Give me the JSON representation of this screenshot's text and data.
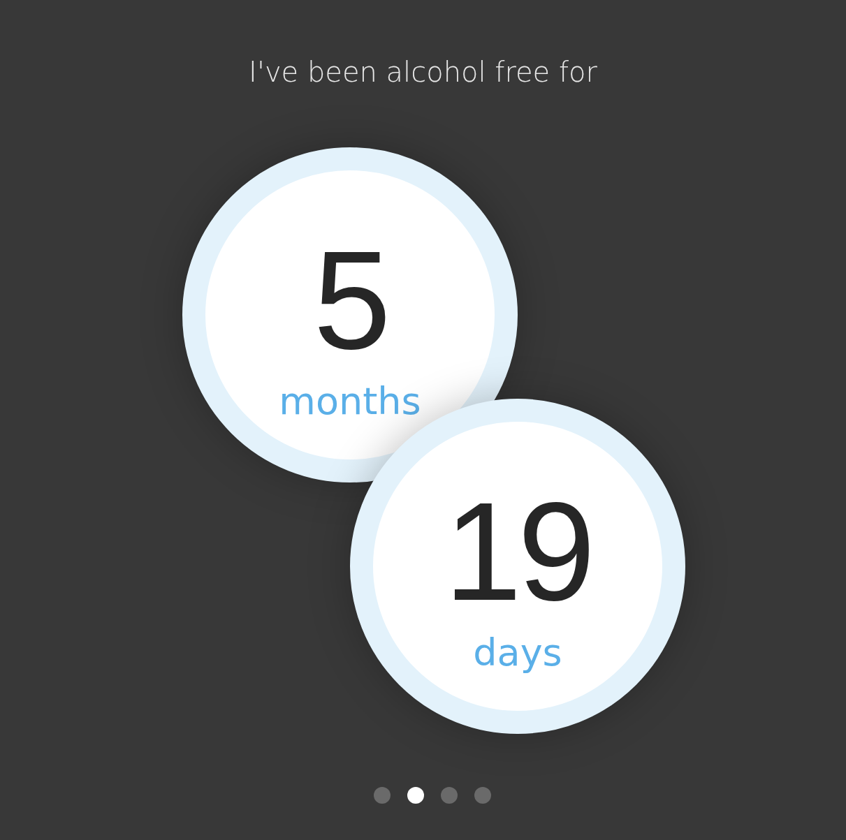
{
  "headline": "I've been alcohol free for",
  "counters": [
    {
      "value": "5",
      "unit": "months"
    },
    {
      "value": "19",
      "unit": "days"
    }
  ],
  "pages": [
    {
      "selected": false
    },
    {
      "selected": true
    },
    {
      "selected": false
    },
    {
      "selected": false
    }
  ]
}
